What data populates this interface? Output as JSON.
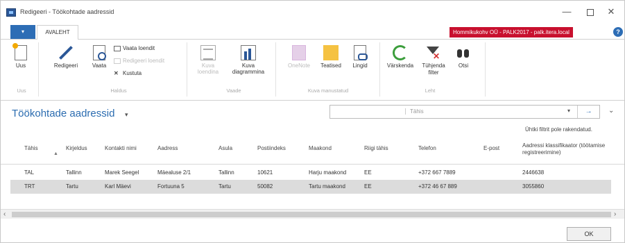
{
  "window": {
    "title": "Redigeeri - Töökohtade aadressid",
    "minimize": "—",
    "maximize": "",
    "close": "✕"
  },
  "ribbon_tabs": {
    "file_tab": "▾",
    "home": "AVALEHT"
  },
  "company_badge": "Hommikukohv OÜ - PALK2017 - palk.itera.local",
  "help": "?",
  "ribbon": {
    "new": "Uus",
    "edit": "Redigeeri",
    "view": "Vaata",
    "view_list": "Vaata loendit",
    "edit_list": "Redigeeri loendit",
    "delete": "Kustuta",
    "group_manage": "Haldus",
    "show_list": "Kuva loendina",
    "show_chart": "Kuva diagrammina",
    "group_view": "Vaade",
    "onenote": "OneNote",
    "notes": "Teatised",
    "links": "Lingid",
    "group_show_attached": "Kuva manustatud",
    "refresh": "Värskenda",
    "clear_filter": "Tühjenda filter",
    "find": "Otsi",
    "group_page": "Leht"
  },
  "page": {
    "title": "Töökohtade aadressid",
    "title_arrow": "▾",
    "search_field": "Tähis",
    "search_dropdown": "▾",
    "search_go": "→",
    "collapse": "⌄",
    "filter_note": "Ühtki filtrit pole rakendatud."
  },
  "table": {
    "columns": {
      "code": "Tähis",
      "sort_indicator": "▲",
      "description": "Kirjeldus",
      "contact": "Kontakti nimi",
      "address": "Aadress",
      "city": "Asula",
      "postcode": "Postiindeks",
      "county": "Maakond",
      "country": "Riigi tähis",
      "phone": "Telefon",
      "email": "E-post",
      "classifier": "Aadressi klassifikaator (töötamise registreerimine)"
    },
    "rows": [
      {
        "code": "TAL",
        "description": "Tallinn",
        "contact": "Marek Seegel",
        "address": "Mäealuse 2/1",
        "city": "Tallinn",
        "postcode": "10621",
        "county": "Harju maakond",
        "country": "EE",
        "phone": "+372 667 7889",
        "email": "",
        "classifier": "2446638"
      },
      {
        "code": "TRT",
        "description": "Tartu",
        "contact": "Karl Mäevi",
        "address": "Fortuuna 5",
        "city": "Tartu",
        "postcode": "50082",
        "county": "Tartu maakond",
        "country": "EE",
        "phone": "+372 46 67 889",
        "email": "",
        "classifier": "3055860"
      }
    ]
  },
  "scroll": {
    "left": "‹",
    "right": "›"
  },
  "ok_button": "OK"
}
